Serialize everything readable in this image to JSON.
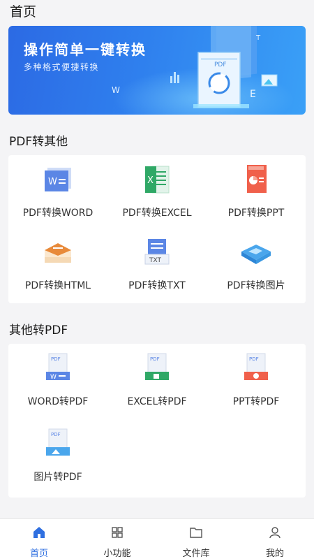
{
  "header": {
    "title": "首页"
  },
  "banner": {
    "title": "操作简单一键转换",
    "subtitle": "多种格式便捷转换",
    "doc_label": "PDF"
  },
  "section_pdf_to_other": {
    "title": "PDF转其他",
    "items": [
      {
        "label": "PDF转换WORD",
        "icon": "word-doc-icon"
      },
      {
        "label": "PDF转换EXCEL",
        "icon": "excel-doc-icon"
      },
      {
        "label": "PDF转换PPT",
        "icon": "ppt-doc-icon"
      },
      {
        "label": "PDF转换HTML",
        "icon": "html-stack-icon"
      },
      {
        "label": "PDF转换TXT",
        "icon": "txt-doc-icon"
      },
      {
        "label": "PDF转换图片",
        "icon": "image-folder-icon"
      }
    ]
  },
  "section_other_to_pdf": {
    "title": "其他转PDF",
    "items": [
      {
        "label": "WORD转PDF",
        "icon": "word-to-pdf-icon"
      },
      {
        "label": "EXCEL转PDF",
        "icon": "excel-to-pdf-icon"
      },
      {
        "label": "PPT转PDF",
        "icon": "ppt-to-pdf-icon"
      },
      {
        "label": "图片转PDF",
        "icon": "image-to-pdf-icon"
      }
    ]
  },
  "tabbar": {
    "items": [
      {
        "label": "首页",
        "icon": "home-icon",
        "active": true
      },
      {
        "label": "小功能",
        "icon": "grid-icon",
        "active": false
      },
      {
        "label": "文件库",
        "icon": "folder-icon",
        "active": false
      },
      {
        "label": "我的",
        "icon": "user-icon",
        "active": false
      }
    ]
  },
  "colors": {
    "accent": "#2f6fe0",
    "word": "#4a7be0",
    "excel": "#2fa866",
    "ppt": "#f0604b",
    "html": "#e88a3a"
  }
}
